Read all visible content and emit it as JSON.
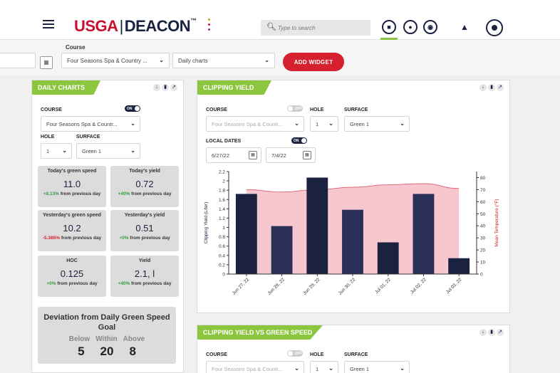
{
  "nav": {
    "logo_primary": "USGA",
    "logo_secondary": "DEACON",
    "trademark": "™",
    "search_placeholder": "Type to search"
  },
  "filters": {
    "course_label": "Course",
    "course_value": "Four Seasons Spa & Country ...",
    "view_value": "Daily charts",
    "add_widget": "ADD WIDGET"
  },
  "daily": {
    "title": "DAILY CHARTS",
    "course_label": "COURSE",
    "toggle": "ON",
    "course_value": "Four Seasons Spa & Countr...",
    "hole_label": "HOLE",
    "surface_label": "SURFACE",
    "hole_value": "1",
    "surface_value": "Green 1",
    "stats": [
      {
        "header": "Today's green speed",
        "value": "11.0",
        "delta": "+8.13%",
        "delta_text": "from previous day",
        "sign": "pos"
      },
      {
        "header": "Today's yield",
        "value": "0.72",
        "delta": "+40%",
        "delta_text": "from previous day",
        "sign": "pos"
      },
      {
        "header": "Yesterday's green speed",
        "value": "10.2",
        "delta": "-5.385%",
        "delta_text": "from previous day",
        "sign": "neg"
      },
      {
        "header": "Yesterday's yield",
        "value": "0.51",
        "delta": "+0%",
        "delta_text": "from previous day",
        "sign": "pos"
      },
      {
        "header": "HOC",
        "value": "0.125",
        "delta": "+0%",
        "delta_text": "from previous day",
        "sign": "pos"
      },
      {
        "header": "Yield",
        "value": "2.1, l",
        "delta": "+40%",
        "delta_text": "from previous day",
        "sign": "pos"
      }
    ],
    "deviation_title": "Deviation from Daily Green Speed Goal",
    "below_label": "Below",
    "within_label": "Within",
    "above_label": "Above",
    "below": "5",
    "within": "20",
    "above": "8"
  },
  "clipping": {
    "title": "CLIPPING YIELD",
    "course_label": "COURSE",
    "toggle": "OFF",
    "hole_label": "HOLE",
    "surface_label": "SURFACE",
    "course_value": "Four Seasons Spa & Countr...",
    "hole_value": "1",
    "surface_value": "Green 1",
    "local_dates_label": "LOCAL DATES",
    "local_toggle": "ON",
    "start_date": "6/27/22",
    "end_date": "7/4/22"
  },
  "chart_data": {
    "type": "bar",
    "categories": [
      "Jun 27, 22",
      "Jun 28, 22",
      "Jun 29, 22",
      "Jun 30, 22",
      "Jul 01, 22",
      "Jul 02, 22",
      "Jul 03, 22"
    ],
    "series": [
      {
        "values": [
          1.72,
          1.03,
          2.07,
          1.38,
          0.68,
          1.72,
          0.34
        ]
      },
      {
        "type": "area",
        "values": [
          70,
          68,
          70,
          72,
          74,
          75,
          71
        ]
      }
    ],
    "ylabel": "Clipping Yield (L/ter)",
    "y2label": "Mean Temperature (°F)",
    "ylim": [
      0,
      2.2
    ],
    "y2lim": [
      0,
      85
    ],
    "yticks": [
      "0",
      "0.2",
      "0.4",
      "0.6",
      "0.8",
      "1",
      "1.2",
      "1.4",
      "1.6",
      "1.8",
      "2",
      "2.2"
    ],
    "y2ticks": [
      "0",
      "10",
      "20",
      "30",
      "40",
      "50",
      "60",
      "70",
      "80"
    ],
    "colors": {
      "bar_dark": "#1b2240",
      "bar_mid": "#2a3058",
      "area_fill": "#f6c7cf",
      "area_line": "#e06a7a",
      "axis_right": "#d6202f"
    }
  },
  "clipping_vs": {
    "title": "CLIPPING YIELD VS GREEN SPEED",
    "course_label": "COURSE",
    "toggle": "OFF",
    "hole_label": "HOLE",
    "surface_label": "SURFACE",
    "course_value": "Four Seasons Spa & Countr...",
    "hole_value": "1",
    "surface_value": "Green 1"
  },
  "colors": {
    "brand_red": "#c8102e",
    "brand_navy": "#1b2240",
    "accent_green": "#8cc63f"
  }
}
